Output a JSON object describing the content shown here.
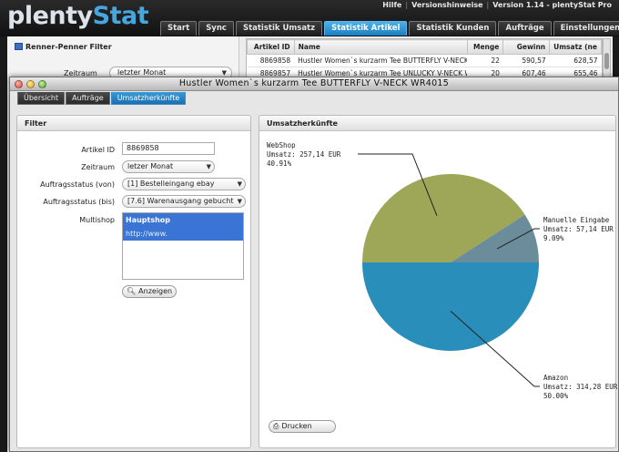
{
  "app": {
    "logo_part1": "plenty",
    "logo_part2": "Stat",
    "top_links": [
      "Hilfe",
      "Versionshinweise",
      "Version 1.14 - plentyStat Pro"
    ],
    "tabs": [
      "Start",
      "Sync",
      "Statistik Umsatz",
      "Statistik Artikel",
      "Statistik Kunden",
      "Aufträge",
      "Einstellungen"
    ],
    "active_tab": "Statistik Artikel"
  },
  "background": {
    "panel_title": "Renner-Penner Filter",
    "zeitraum_label": "Zeitraum",
    "zeitraum_value": "letzter Monat",
    "table": {
      "columns": [
        "Artikel ID",
        "Name",
        "Menge",
        "Gewinn",
        "Umsatz (ne"
      ],
      "rows": [
        [
          "8869858",
          "Hustler Women`s kurzarm Tee  BUTTERFLY V-NECK",
          "22",
          "590,57",
          "628,57"
        ],
        [
          "8869857",
          "Hustler Women`s kurzarm Tee  UNLUCKY V-NECK W",
          "20",
          "607,46",
          "655,46"
        ]
      ]
    }
  },
  "dialog": {
    "title": "Hustler Women`s kurzarm Tee  BUTTERFLY V-NECK WR4015",
    "tabs": [
      "Übersicht",
      "Aufträge",
      "Umsatzherkünfte"
    ],
    "active_tab": "Umsatzherkünfte",
    "filter": {
      "title": "Filter",
      "artikel_id_label": "Artikel ID",
      "artikel_id_value": "8869858",
      "zeitraum_label": "Zeitraum",
      "zeitraum_value": "letzer Monat",
      "status_von_label": "Auftragsstatus (von)",
      "status_von_value": "[1] Bestelleingang ebay",
      "status_bis_label": "Auftragsstatus (bis)",
      "status_bis_value": "[7.6] Warenausgang gebucht",
      "multishop_label": "Multishop",
      "multishop_items": [
        "Hauptshop",
        "http://www."
      ],
      "anzeigen_label": "Anzeigen"
    },
    "chart_panel": {
      "title": "Umsatzherkünfte",
      "drucken_label": "Drucken"
    }
  },
  "chart_data": {
    "type": "pie",
    "title": "Umsatzherkünfte",
    "slices": [
      {
        "name": "WebShop",
        "line2": "Umsatz: 257,14 EUR",
        "percent_label": "40.91%",
        "value": 40.91,
        "color": "#9ea657"
      },
      {
        "name": "Manuelle Eingabe",
        "line2": "Umsatz: 57,14 EUR",
        "percent_label": "9.09%",
        "value": 9.09,
        "color": "#6b8c9a"
      },
      {
        "name": "Amazon",
        "line2": "Umsatz: 314,28 EUR",
        "percent_label": "50.00%",
        "value": 50.0,
        "color": "#2a8ebb"
      }
    ]
  }
}
